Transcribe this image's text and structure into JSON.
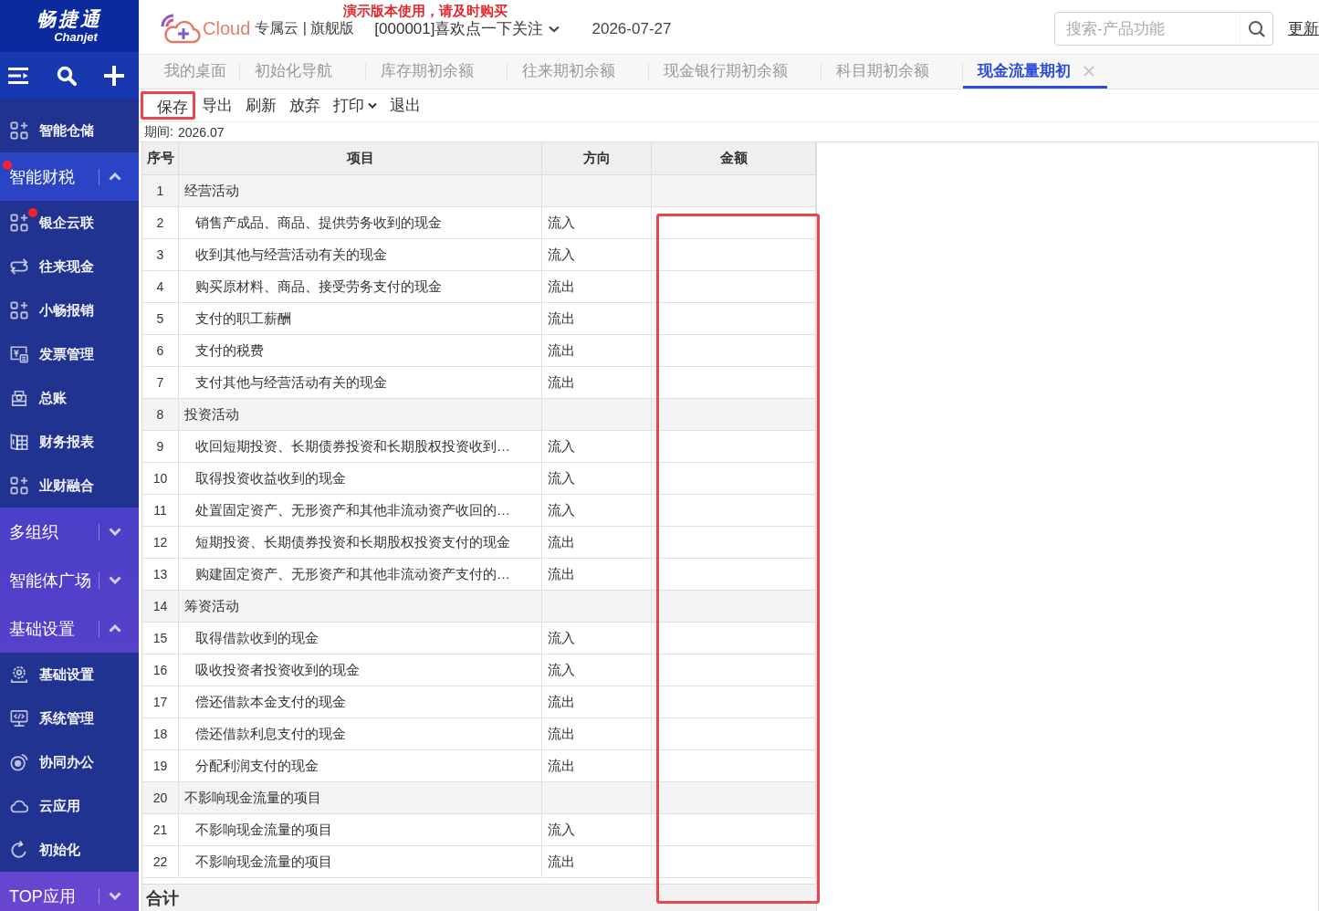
{
  "sidebar": {
    "logo": {
      "title": "畅捷通",
      "subtitle": "Chanjet"
    },
    "entries": [
      {
        "kind": "item",
        "label": "智能仓储",
        "alert": false
      },
      {
        "kind": "group",
        "label": "智能财税",
        "alert": true,
        "expanded": true,
        "children": [
          {
            "kind": "item",
            "label": "银企云联",
            "alert": true
          },
          {
            "kind": "item",
            "label": "往来现金",
            "alert": false
          },
          {
            "kind": "item",
            "label": "小畅报销",
            "alert": false
          },
          {
            "kind": "item",
            "label": "发票管理",
            "alert": false
          },
          {
            "kind": "item",
            "label": "总账",
            "alert": false
          },
          {
            "kind": "item",
            "label": "财务报表",
            "alert": false
          },
          {
            "kind": "item",
            "label": "业财融合",
            "alert": false
          }
        ]
      },
      {
        "kind": "group",
        "label": "多组织",
        "alert": false,
        "expanded": false
      },
      {
        "kind": "group",
        "label": "智能体广场",
        "alert": false,
        "expanded": false
      },
      {
        "kind": "group",
        "label": "基础设置",
        "alert": false,
        "expanded": true,
        "children": [
          {
            "kind": "item",
            "label": "基础设置",
            "alert": false
          },
          {
            "kind": "item",
            "label": "系统管理",
            "alert": false
          },
          {
            "kind": "item",
            "label": "协同办公",
            "alert": false
          },
          {
            "kind": "item",
            "label": "云应用",
            "alert": false
          },
          {
            "kind": "item",
            "label": "初始化",
            "alert": false
          }
        ]
      },
      {
        "kind": "group",
        "label": "TOP应用",
        "alert": false,
        "expanded": false
      }
    ]
  },
  "header": {
    "brand": "Cloud",
    "edition": "专属云 | 旗舰版",
    "notice": "演示版本使用，请及时购买",
    "account": "[000001]喜欢点一下关注",
    "date": "2026-07-27",
    "search": {
      "placeholder": "搜索-产品功能"
    },
    "update_link": "更新"
  },
  "tabs": [
    {
      "label": "我的桌面",
      "selected": false
    },
    {
      "label": "初始化导航",
      "selected": false
    },
    {
      "label": "库存期初余额",
      "selected": false
    },
    {
      "label": "往来期初余额",
      "selected": false
    },
    {
      "label": "现金银行期初余额",
      "selected": false
    },
    {
      "label": "科目期初余额",
      "selected": false
    },
    {
      "label": "现金流量期初",
      "selected": true
    }
  ],
  "toolbar": [
    {
      "label": "保存",
      "highlighted": true,
      "dropdown": false
    },
    {
      "label": "导出",
      "highlighted": false,
      "dropdown": false
    },
    {
      "label": "刷新",
      "highlighted": false,
      "dropdown": false
    },
    {
      "label": "放弃",
      "highlighted": false,
      "dropdown": false
    },
    {
      "label": "打印",
      "highlighted": false,
      "dropdown": true
    },
    {
      "label": "退出",
      "highlighted": false,
      "dropdown": false
    }
  ],
  "period": {
    "label": "期间:",
    "value": "2026.07"
  },
  "table": {
    "columns": [
      "序号",
      "项目",
      "方向",
      "金额"
    ],
    "amount_column_highlighted": true,
    "rows": [
      {
        "kind": "section",
        "no": "1",
        "item": "经营活动"
      },
      {
        "kind": "item",
        "no": "2",
        "item": "销售产成品、商品、提供劳务收到的现金",
        "direction": "流入"
      },
      {
        "kind": "item",
        "no": "3",
        "item": "收到其他与经营活动有关的现金",
        "direction": "流入"
      },
      {
        "kind": "item",
        "no": "4",
        "item": "购买原材料、商品、接受劳务支付的现金",
        "direction": "流出"
      },
      {
        "kind": "item",
        "no": "5",
        "item": "支付的职工薪酬",
        "direction": "流出"
      },
      {
        "kind": "item",
        "no": "6",
        "item": "支付的税费",
        "direction": "流出"
      },
      {
        "kind": "item",
        "no": "7",
        "item": "支付其他与经营活动有关的现金",
        "direction": "流出"
      },
      {
        "kind": "section",
        "no": "8",
        "item": "投资活动"
      },
      {
        "kind": "item",
        "no": "9",
        "item": "收回短期投资、长期债券投资和长期股权投资收到…",
        "direction": "流入"
      },
      {
        "kind": "item",
        "no": "10",
        "item": "取得投资收益收到的现金",
        "direction": "流入"
      },
      {
        "kind": "item",
        "no": "11",
        "item": "处置固定资产、无形资产和其他非流动资产收回的…",
        "direction": "流入"
      },
      {
        "kind": "item",
        "no": "12",
        "item": "短期投资、长期债券投资和长期股权投资支付的现金",
        "direction": "流出"
      },
      {
        "kind": "item",
        "no": "13",
        "item": "购建固定资产、无形资产和其他非流动资产支付的…",
        "direction": "流出"
      },
      {
        "kind": "section",
        "no": "14",
        "item": "筹资活动"
      },
      {
        "kind": "item",
        "no": "15",
        "item": "取得借款收到的现金",
        "direction": "流入"
      },
      {
        "kind": "item",
        "no": "16",
        "item": "吸收投资者投资收到的现金",
        "direction": "流入"
      },
      {
        "kind": "item",
        "no": "17",
        "item": "偿还借款本金支付的现金",
        "direction": "流出"
      },
      {
        "kind": "item",
        "no": "18",
        "item": "偿还借款利息支付的现金",
        "direction": "流出"
      },
      {
        "kind": "item",
        "no": "19",
        "item": "分配利润支付的现金",
        "direction": "流出"
      },
      {
        "kind": "section",
        "no": "20",
        "item": "不影响现金流量的项目"
      },
      {
        "kind": "item",
        "no": "21",
        "item": "不影响现金流量的项目",
        "direction": "流入"
      },
      {
        "kind": "item",
        "no": "22",
        "item": "不影响现金流量的项目",
        "direction": "流出"
      }
    ],
    "footer": "合计"
  }
}
